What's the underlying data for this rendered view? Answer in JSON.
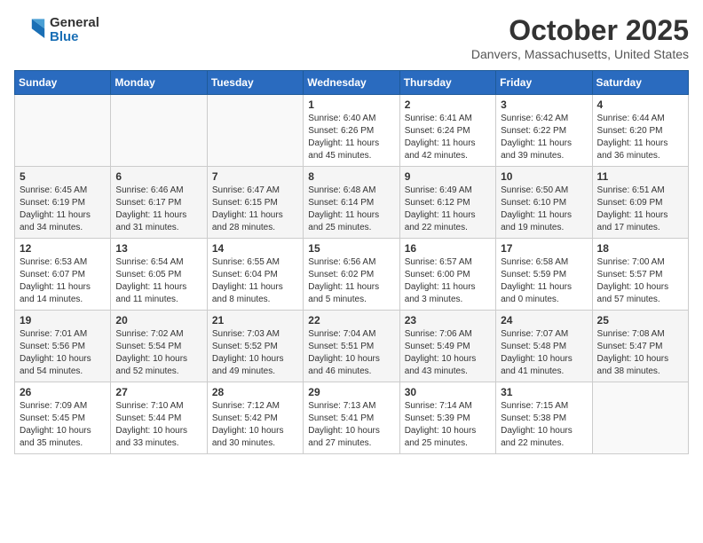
{
  "logo": {
    "general": "General",
    "blue": "Blue"
  },
  "title": "October 2025",
  "location": "Danvers, Massachusetts, United States",
  "days_header": [
    "Sunday",
    "Monday",
    "Tuesday",
    "Wednesday",
    "Thursday",
    "Friday",
    "Saturday"
  ],
  "weeks": [
    [
      {
        "day": "",
        "sunrise": "",
        "sunset": "",
        "daylight": ""
      },
      {
        "day": "",
        "sunrise": "",
        "sunset": "",
        "daylight": ""
      },
      {
        "day": "",
        "sunrise": "",
        "sunset": "",
        "daylight": ""
      },
      {
        "day": "1",
        "sunrise": "Sunrise: 6:40 AM",
        "sunset": "Sunset: 6:26 PM",
        "daylight": "Daylight: 11 hours and 45 minutes."
      },
      {
        "day": "2",
        "sunrise": "Sunrise: 6:41 AM",
        "sunset": "Sunset: 6:24 PM",
        "daylight": "Daylight: 11 hours and 42 minutes."
      },
      {
        "day": "3",
        "sunrise": "Sunrise: 6:42 AM",
        "sunset": "Sunset: 6:22 PM",
        "daylight": "Daylight: 11 hours and 39 minutes."
      },
      {
        "day": "4",
        "sunrise": "Sunrise: 6:44 AM",
        "sunset": "Sunset: 6:20 PM",
        "daylight": "Daylight: 11 hours and 36 minutes."
      }
    ],
    [
      {
        "day": "5",
        "sunrise": "Sunrise: 6:45 AM",
        "sunset": "Sunset: 6:19 PM",
        "daylight": "Daylight: 11 hours and 34 minutes."
      },
      {
        "day": "6",
        "sunrise": "Sunrise: 6:46 AM",
        "sunset": "Sunset: 6:17 PM",
        "daylight": "Daylight: 11 hours and 31 minutes."
      },
      {
        "day": "7",
        "sunrise": "Sunrise: 6:47 AM",
        "sunset": "Sunset: 6:15 PM",
        "daylight": "Daylight: 11 hours and 28 minutes."
      },
      {
        "day": "8",
        "sunrise": "Sunrise: 6:48 AM",
        "sunset": "Sunset: 6:14 PM",
        "daylight": "Daylight: 11 hours and 25 minutes."
      },
      {
        "day": "9",
        "sunrise": "Sunrise: 6:49 AM",
        "sunset": "Sunset: 6:12 PM",
        "daylight": "Daylight: 11 hours and 22 minutes."
      },
      {
        "day": "10",
        "sunrise": "Sunrise: 6:50 AM",
        "sunset": "Sunset: 6:10 PM",
        "daylight": "Daylight: 11 hours and 19 minutes."
      },
      {
        "day": "11",
        "sunrise": "Sunrise: 6:51 AM",
        "sunset": "Sunset: 6:09 PM",
        "daylight": "Daylight: 11 hours and 17 minutes."
      }
    ],
    [
      {
        "day": "12",
        "sunrise": "Sunrise: 6:53 AM",
        "sunset": "Sunset: 6:07 PM",
        "daylight": "Daylight: 11 hours and 14 minutes."
      },
      {
        "day": "13",
        "sunrise": "Sunrise: 6:54 AM",
        "sunset": "Sunset: 6:05 PM",
        "daylight": "Daylight: 11 hours and 11 minutes."
      },
      {
        "day": "14",
        "sunrise": "Sunrise: 6:55 AM",
        "sunset": "Sunset: 6:04 PM",
        "daylight": "Daylight: 11 hours and 8 minutes."
      },
      {
        "day": "15",
        "sunrise": "Sunrise: 6:56 AM",
        "sunset": "Sunset: 6:02 PM",
        "daylight": "Daylight: 11 hours and 5 minutes."
      },
      {
        "day": "16",
        "sunrise": "Sunrise: 6:57 AM",
        "sunset": "Sunset: 6:00 PM",
        "daylight": "Daylight: 11 hours and 3 minutes."
      },
      {
        "day": "17",
        "sunrise": "Sunrise: 6:58 AM",
        "sunset": "Sunset: 5:59 PM",
        "daylight": "Daylight: 11 hours and 0 minutes."
      },
      {
        "day": "18",
        "sunrise": "Sunrise: 7:00 AM",
        "sunset": "Sunset: 5:57 PM",
        "daylight": "Daylight: 10 hours and 57 minutes."
      }
    ],
    [
      {
        "day": "19",
        "sunrise": "Sunrise: 7:01 AM",
        "sunset": "Sunset: 5:56 PM",
        "daylight": "Daylight: 10 hours and 54 minutes."
      },
      {
        "day": "20",
        "sunrise": "Sunrise: 7:02 AM",
        "sunset": "Sunset: 5:54 PM",
        "daylight": "Daylight: 10 hours and 52 minutes."
      },
      {
        "day": "21",
        "sunrise": "Sunrise: 7:03 AM",
        "sunset": "Sunset: 5:52 PM",
        "daylight": "Daylight: 10 hours and 49 minutes."
      },
      {
        "day": "22",
        "sunrise": "Sunrise: 7:04 AM",
        "sunset": "Sunset: 5:51 PM",
        "daylight": "Daylight: 10 hours and 46 minutes."
      },
      {
        "day": "23",
        "sunrise": "Sunrise: 7:06 AM",
        "sunset": "Sunset: 5:49 PM",
        "daylight": "Daylight: 10 hours and 43 minutes."
      },
      {
        "day": "24",
        "sunrise": "Sunrise: 7:07 AM",
        "sunset": "Sunset: 5:48 PM",
        "daylight": "Daylight: 10 hours and 41 minutes."
      },
      {
        "day": "25",
        "sunrise": "Sunrise: 7:08 AM",
        "sunset": "Sunset: 5:47 PM",
        "daylight": "Daylight: 10 hours and 38 minutes."
      }
    ],
    [
      {
        "day": "26",
        "sunrise": "Sunrise: 7:09 AM",
        "sunset": "Sunset: 5:45 PM",
        "daylight": "Daylight: 10 hours and 35 minutes."
      },
      {
        "day": "27",
        "sunrise": "Sunrise: 7:10 AM",
        "sunset": "Sunset: 5:44 PM",
        "daylight": "Daylight: 10 hours and 33 minutes."
      },
      {
        "day": "28",
        "sunrise": "Sunrise: 7:12 AM",
        "sunset": "Sunset: 5:42 PM",
        "daylight": "Daylight: 10 hours and 30 minutes."
      },
      {
        "day": "29",
        "sunrise": "Sunrise: 7:13 AM",
        "sunset": "Sunset: 5:41 PM",
        "daylight": "Daylight: 10 hours and 27 minutes."
      },
      {
        "day": "30",
        "sunrise": "Sunrise: 7:14 AM",
        "sunset": "Sunset: 5:39 PM",
        "daylight": "Daylight: 10 hours and 25 minutes."
      },
      {
        "day": "31",
        "sunrise": "Sunrise: 7:15 AM",
        "sunset": "Sunset: 5:38 PM",
        "daylight": "Daylight: 10 hours and 22 minutes."
      },
      {
        "day": "",
        "sunrise": "",
        "sunset": "",
        "daylight": ""
      }
    ]
  ]
}
